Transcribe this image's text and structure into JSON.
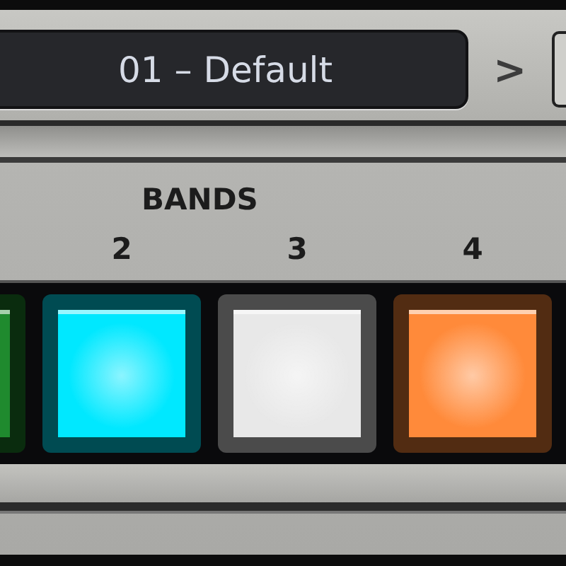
{
  "preset": {
    "name": "01 – Default",
    "next": ">"
  },
  "bands_title": "BANDS",
  "bands": [
    {
      "color": "#1f8a2e"
    },
    {
      "label": "2",
      "color": "#00e8ff"
    },
    {
      "label": "3",
      "color": "#e8e8e8"
    },
    {
      "label": "4",
      "color": "#ff8a3a"
    }
  ]
}
